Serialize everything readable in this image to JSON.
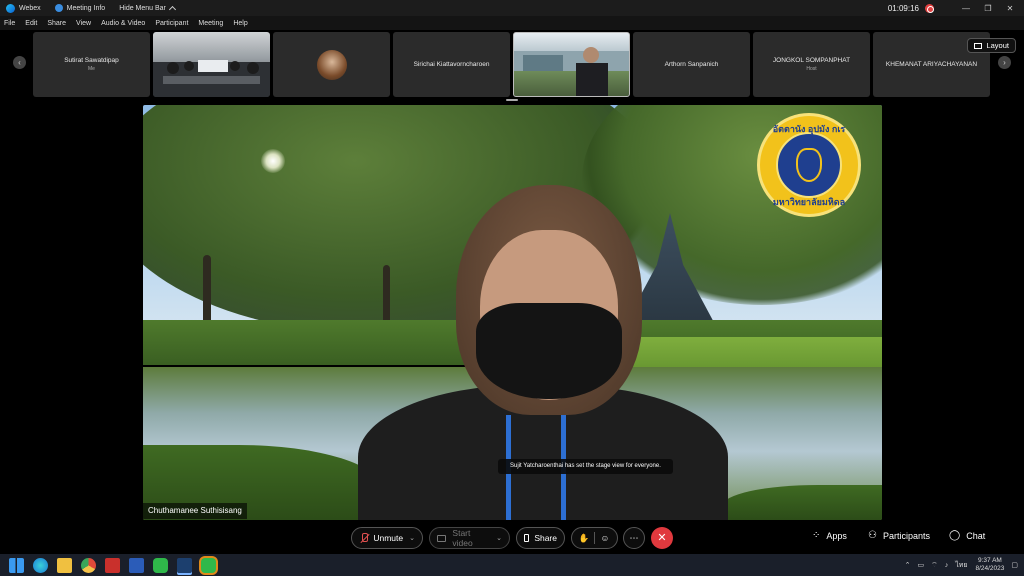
{
  "titlebar": {
    "app_name": "Webex",
    "meeting_info": "Meeting Info",
    "hide_menu": "Hide Menu Bar",
    "timer": "01:09:16",
    "minimize": "—",
    "restore": "❐",
    "close": "✕"
  },
  "menu": {
    "items": [
      "File",
      "Edit",
      "Share",
      "View",
      "Audio & Video",
      "Participant",
      "Meeting",
      "Help"
    ]
  },
  "participants": [
    {
      "name": "Sutirat Sawatdipap",
      "sub": "Me"
    },
    {
      "name": "",
      "sub": ""
    },
    {
      "name": "",
      "sub": ""
    },
    {
      "name": "Sirichai Kiattavorncharoen",
      "sub": ""
    },
    {
      "name": "",
      "sub": ""
    },
    {
      "name": "Arthorn Sanpanich",
      "sub": ""
    },
    {
      "name": "JONGKOL SOMPANPHAT",
      "sub": "Host"
    },
    {
      "name": "KHEMANAT ARIYACHAYANAN",
      "sub": ""
    }
  ],
  "layout_label": "Layout",
  "stage": {
    "speaker_name": "Chuthamanee Suthisisang",
    "notification": "Sujit Yatcharoenthai has set the stage view for everyone.",
    "seal_top": "อัตตานัง อุปมัง กเร",
    "seal_bottom": "มหาวิทยาลัยมหิดล"
  },
  "controls": {
    "unmute": "Unmute",
    "start_video": "Start video",
    "share": "Share",
    "apps": "Apps",
    "participants": "Participants",
    "chat": "Chat"
  },
  "taskbar": {
    "time": "9:37 AM",
    "date": "8/24/2023",
    "language": "ไทย"
  }
}
